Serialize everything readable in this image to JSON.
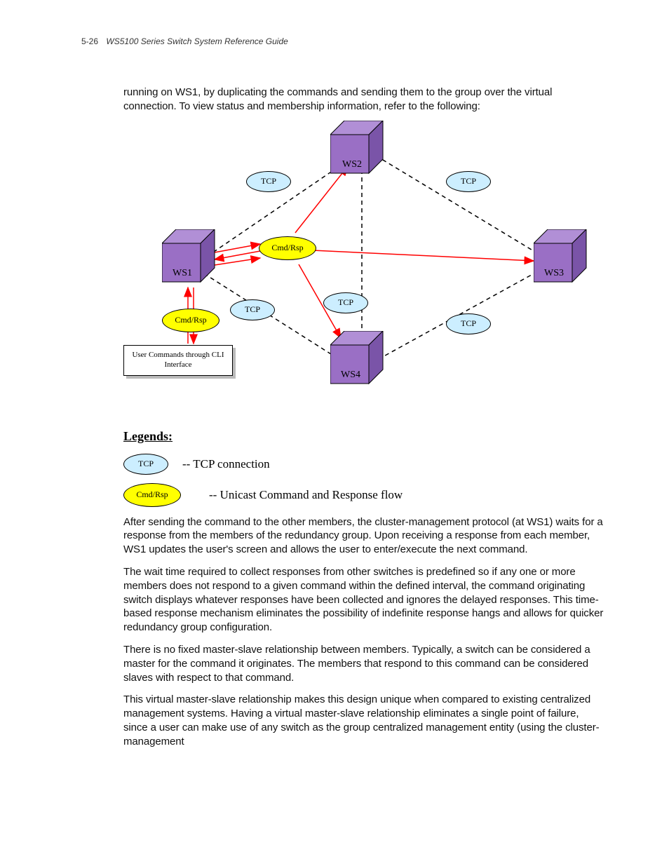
{
  "header": {
    "page_number": "5-26",
    "title": "WS5100 Series Switch System Reference Guide"
  },
  "paragraphs": {
    "p1": "running on WS1, by duplicating the commands and sending them to the group over the virtual connection. To view status and membership information, refer to the following:",
    "p2": "After sending the command to the other members, the cluster-management protocol (at WS1) waits for a response from the members of the redundancy group. Upon receiving a response from each member, WS1 updates the user's screen and allows the user to enter/execute the next command.",
    "p3": "The wait time required to collect responses from other switches is predefined so if any one or more members does not respond to a given command within the defined interval, the command originating switch displays whatever responses have been collected and ignores the delayed responses. This time-based response mechanism eliminates the possibility of indefinite response hangs and allows for quicker redundancy group configuration.",
    "p4": "There is no fixed master-slave relationship between members. Typically, a switch can be considered a master for the command it originates. The members that respond to this command can be considered slaves with respect to that command.",
    "p5": "This virtual master-slave relationship makes this design unique when compared to existing centralized management systems. Having a virtual master-slave relationship eliminates a single point of failure, since a user can make use of any switch as the group centralized management entity (using the cluster-management"
  },
  "diagram": {
    "nodes": {
      "ws1": "WS1",
      "ws2": "WS2",
      "ws3": "WS3",
      "ws4": "WS4"
    },
    "tcp_label": "TCP",
    "cmd_label": "Cmd/Rsp",
    "cli_box": "User Commands through CLI Interface"
  },
  "legends": {
    "title": "Legends:",
    "tcp_label": "TCP",
    "tcp_desc": "-- TCP connection",
    "cmd_label": "Cmd/Rsp",
    "cmd_desc": "-- Unicast Command and Response flow"
  }
}
